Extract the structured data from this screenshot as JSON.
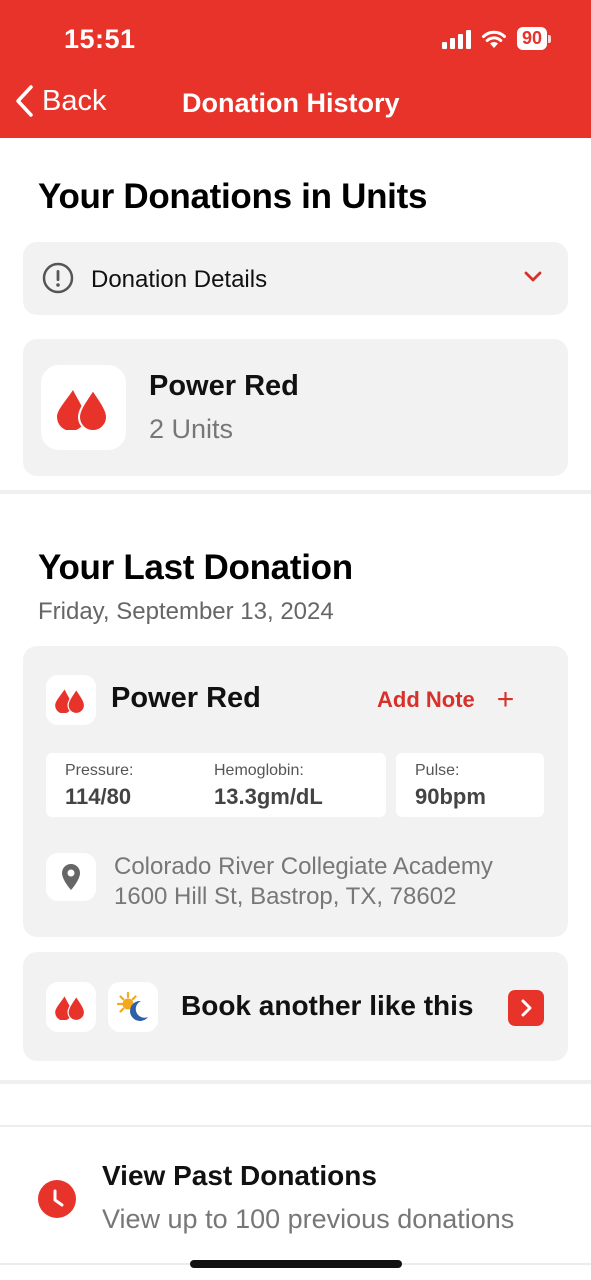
{
  "status_bar": {
    "time": "15:51",
    "battery": "90"
  },
  "nav": {
    "back_label": "Back",
    "title": "Donation History"
  },
  "units_section": {
    "heading": "Your Donations in Units",
    "details_label": "Donation Details",
    "donation_type": "Power Red",
    "units": "2 Units"
  },
  "last_donation": {
    "heading": "Your Last Donation",
    "date": "Friday, September 13, 2024",
    "type": "Power Red",
    "add_note_label": "Add Note",
    "stats": [
      {
        "label": "Pressure:",
        "value": "114/80"
      },
      {
        "label": "Hemoglobin:",
        "value": "13.3gm/dL"
      },
      {
        "label": "Pulse:",
        "value": "90bpm"
      }
    ],
    "location_name": "Colorado River Collegiate Academy",
    "location_address": "1600 Hill St, Bastrop, TX, 78602",
    "book_label": "Book another like this"
  },
  "past_donations": {
    "title": "View Past Donations",
    "subtitle": "View up to 100 previous donations"
  },
  "colors": {
    "brand_red": "#e8332a",
    "card_bg": "#f2f2f3"
  }
}
